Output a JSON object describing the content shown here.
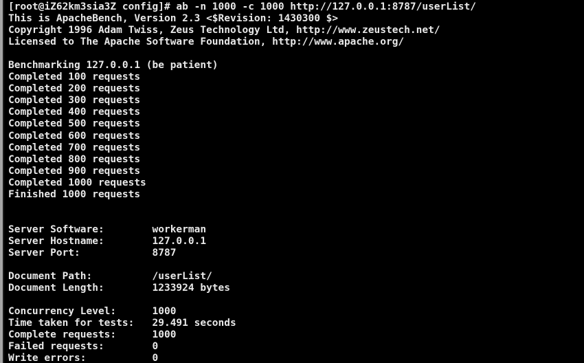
{
  "window": {
    "type": "terminal-emulator",
    "background_color": "#000000",
    "foreground_color": "#e8e8e8",
    "edge_color": "#a6a6a6",
    "columns": 102,
    "rows": 31
  },
  "terminal": {
    "prompt": "[root@iZ62km3sia3Z config]#",
    "command": "ab -n 1000 -c 1000 http://127.0.0.1:8787/userList/",
    "lines": [
      "[root@iZ62km3sia3Z config]# ab -n 1000 -c 1000 http://127.0.0.1:8787/userList/",
      "This is ApacheBench, Version 2.3 <$Revision: 1430300 $>",
      "Copyright 1996 Adam Twiss, Zeus Technology Ltd, http://www.zeustech.net/",
      "Licensed to The Apache Software Foundation, http://www.apache.org/",
      "",
      "Benchmarking 127.0.0.1 (be patient)",
      "Completed 100 requests",
      "Completed 200 requests",
      "Completed 300 requests",
      "Completed 400 requests",
      "Completed 500 requests",
      "Completed 600 requests",
      "Completed 700 requests",
      "Completed 800 requests",
      "Completed 900 requests",
      "Completed 1000 requests",
      "Finished 1000 requests",
      "",
      "",
      "Server Software:        workerman",
      "Server Hostname:        127.0.0.1",
      "Server Port:            8787",
      "",
      "Document Path:          /userList/",
      "Document Length:        1233924 bytes",
      "",
      "Concurrency Level:      1000",
      "Time taken for tests:   29.491 seconds",
      "Complete requests:      1000",
      "Failed requests:        0",
      "Write errors:           0"
    ]
  },
  "benchmark": {
    "tool": "ApacheBench",
    "version": "2.3",
    "revision": "1430300",
    "copyright": "Copyright 1996 Adam Twiss, Zeus Technology Ltd, http://www.zeustech.net/",
    "license": "Licensed to The Apache Software Foundation, http://www.apache.org/",
    "zeus_url": "http://www.zeustech.net/",
    "apache_url": "http://www.apache.org/",
    "target_url": "http://127.0.0.1:8787/userList/",
    "benchmarking_host": "127.0.0.1",
    "benchmarking_note": "(be patient)",
    "requests_total": "1000",
    "concurrency_arg": "1000",
    "progress": [
      "Completed 100 requests",
      "Completed 200 requests",
      "Completed 300 requests",
      "Completed 400 requests",
      "Completed 500 requests",
      "Completed 600 requests",
      "Completed 700 requests",
      "Completed 800 requests",
      "Completed 900 requests",
      "Completed 1000 requests",
      "Finished 1000 requests"
    ],
    "results": [
      {
        "label": "Server Software:",
        "value": "workerman"
      },
      {
        "label": "Server Hostname:",
        "value": "127.0.0.1"
      },
      {
        "label": "Server Port:",
        "value": "8787"
      },
      {
        "label": "Document Path:",
        "value": "/userList/"
      },
      {
        "label": "Document Length:",
        "value": "1233924 bytes"
      },
      {
        "label": "Concurrency Level:",
        "value": "1000"
      },
      {
        "label": "Time taken for tests:",
        "value": "29.491 seconds"
      },
      {
        "label": "Complete requests:",
        "value": "1000"
      },
      {
        "label": "Failed requests:",
        "value": "0"
      },
      {
        "label": "Write errors:",
        "value": "0"
      }
    ]
  }
}
